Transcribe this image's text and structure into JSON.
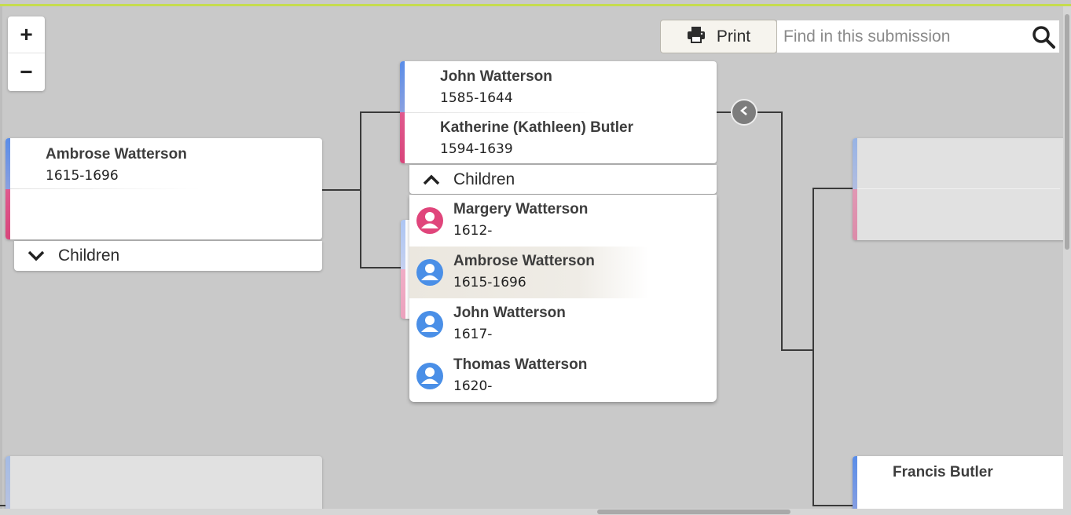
{
  "toolbar": {
    "zoom_in": "+",
    "zoom_out": "−",
    "print_label": "Print",
    "search_placeholder": "Find in this submission"
  },
  "tree": {
    "focus": {
      "name": "Ambrose Watterson",
      "dates": "1615-1696",
      "children_label": "Children",
      "children_expanded": false
    },
    "parents": {
      "father": {
        "name": "John Watterson",
        "dates": "1585-1644"
      },
      "mother": {
        "name": "Katherine (Kathleen) Butler",
        "dates": "1594-1639"
      },
      "children_label": "Children",
      "children_expanded": true
    },
    "children": [
      {
        "name": "Margery Watterson",
        "dates": "1612-",
        "gender": "female",
        "selected": false
      },
      {
        "name": "Ambrose Watterson",
        "dates": "1615-1696",
        "gender": "male",
        "selected": true
      },
      {
        "name": "John Watterson",
        "dates": "1617-",
        "gender": "male",
        "selected": false
      },
      {
        "name": "Thomas Watterson",
        "dates": "1620-",
        "gender": "male",
        "selected": false
      }
    ],
    "grandparents_mother_side": {
      "father": {
        "name": "Francis Butler"
      }
    }
  },
  "colors": {
    "male": "#4a8fe7",
    "female": "#e0457b",
    "accent_top": "#c5dc4e",
    "background": "#c9c9c9"
  },
  "icons": {
    "print": "printer-icon",
    "search": "search-icon",
    "collapse": "chevron-left-icon",
    "expand": "chevron-up-icon",
    "collapsed": "chevron-down-icon",
    "person": "person-icon"
  }
}
